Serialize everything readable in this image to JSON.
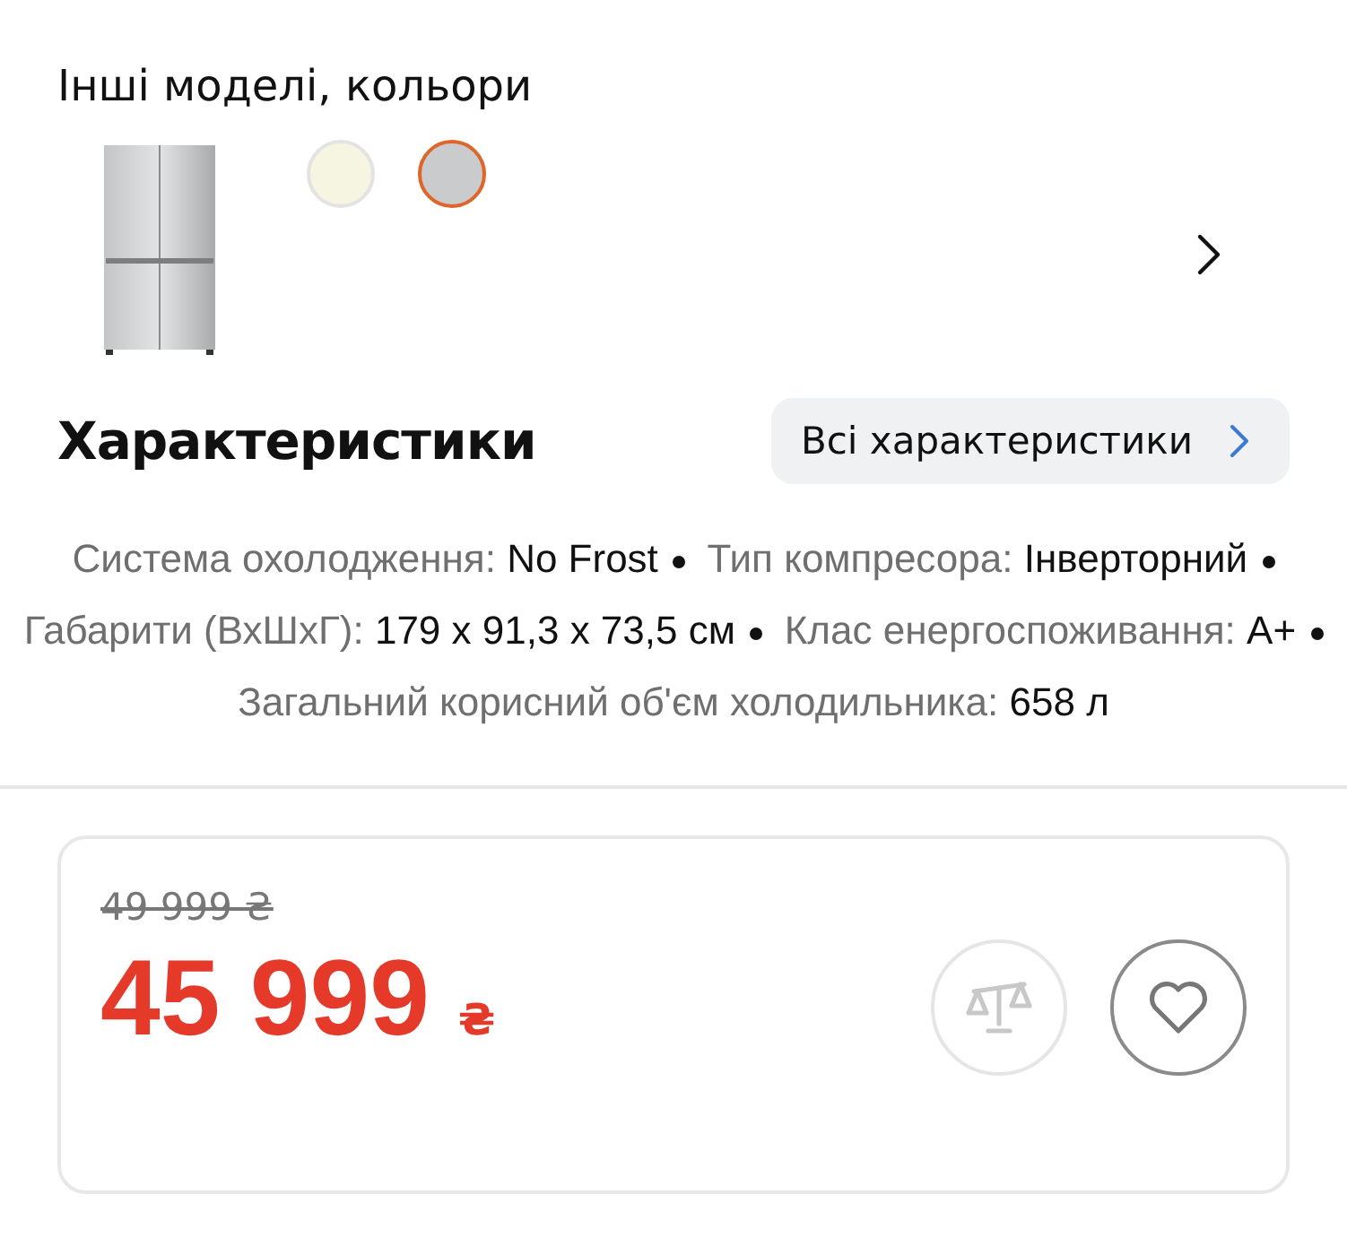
{
  "models": {
    "title": "Інші моделі, кольори",
    "swatches": [
      {
        "color": "#f6f5e1",
        "selected": false
      },
      {
        "color": "#c9cbcd",
        "selected": true
      }
    ]
  },
  "specs": {
    "title": "Характеристики",
    "all_button": "Всі характеристики",
    "items": [
      {
        "label": "Система охолодження:",
        "value": "No Frost"
      },
      {
        "label": "Тип компресора:",
        "value": "Інверторний"
      },
      {
        "label": "Габарити (ВхШхГ):",
        "value": "179 x 91,3 x 73,5 см"
      },
      {
        "label": "Клас енергоспоживання:",
        "value": "A+"
      },
      {
        "label": "Загальний корисний об'єм холодильника:",
        "value": "658 л"
      }
    ]
  },
  "price": {
    "old": "49 999 ₴",
    "amount": "45 999",
    "currency": "₴",
    "compare_disabled": true,
    "favorite": false
  }
}
